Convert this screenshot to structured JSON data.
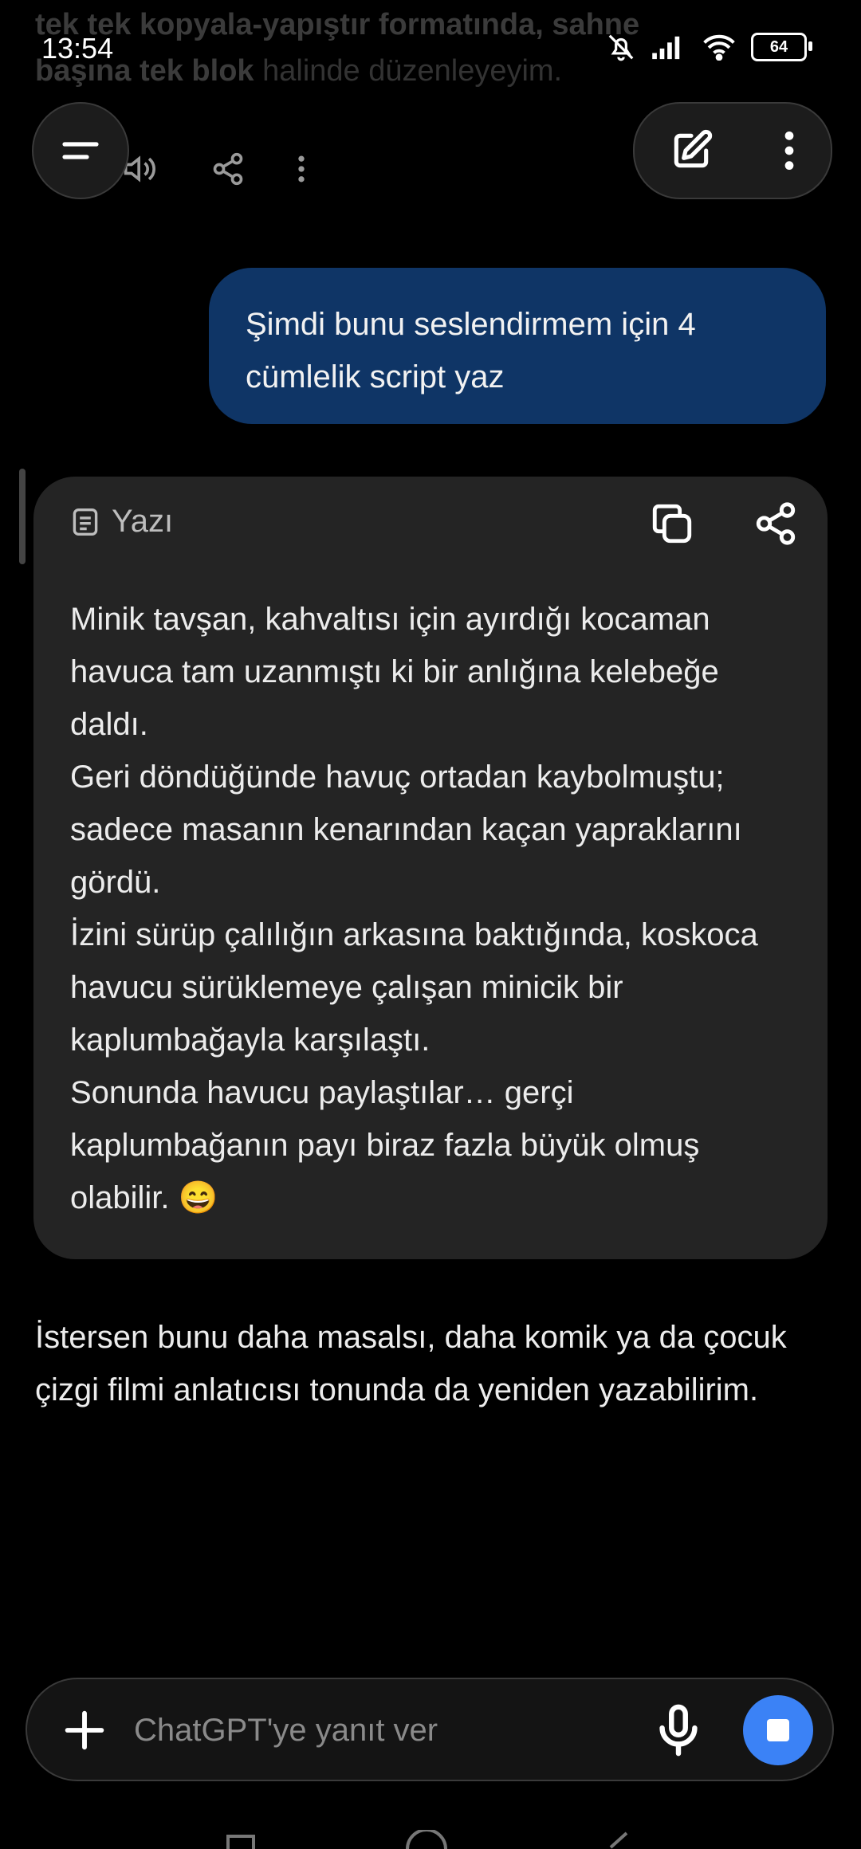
{
  "status_bar": {
    "time": "13:54",
    "battery": "64"
  },
  "previous_message": {
    "line1": "tek tek kopyala-yapıştır formatında, sahne",
    "line2_bold": "başına tek blok",
    "line2_rest": " halinde düzenleyeyim."
  },
  "user_message": "Şimdi bunu seslendirmem için 4 cümlelik script yaz",
  "writing_card": {
    "label": "Yazı",
    "paragraphs": [
      "Minik tavşan, kahvaltısı için ayırdığı kocaman havuca tam uzanmıştı ki bir anlığına kelebeğe daldı.",
      "Geri döndüğünde havuç ortadan kaybolmuştu; sadece masanın kenarından kaçan yapraklarını gördü.",
      "İzini sürüp çalılığın arkasına baktığında, koskoca havucu sürüklemeye çalışan minicik bir kaplumbağayla karşılaştı.",
      "Sonunda havucu paylaştılar… gerçi kaplumbağanın payı biraz fazla büyük olmuş olabilir. 😄"
    ]
  },
  "followup": "İstersen bunu daha masalsı, daha komik ya da çocuk çizgi filmi anlatıcısı tonunda da yeniden yazabilirim.",
  "composer": {
    "placeholder": "ChatGPT'ye yanıt ver"
  },
  "icons": {
    "menu": "menu-icon",
    "edit": "edit-icon",
    "more": "more-vertical-icon",
    "copy": "copy-icon",
    "share": "share-icon",
    "document": "document-icon",
    "plus": "plus-icon",
    "mic": "microphone-icon",
    "stop": "stop-icon"
  },
  "colors": {
    "user_bubble": "#0f3566",
    "card": "#242424",
    "accent": "#3b82f6"
  }
}
